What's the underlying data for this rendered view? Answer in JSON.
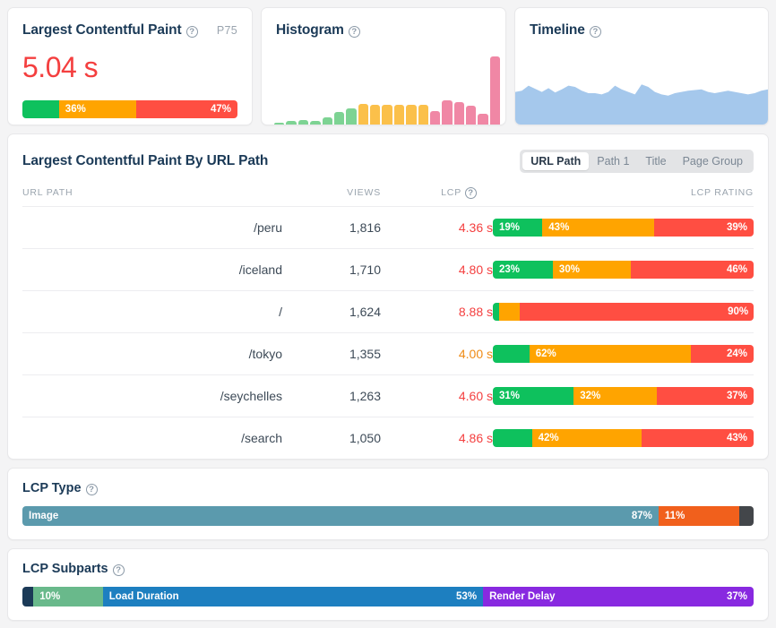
{
  "lcp_card": {
    "title": "Largest Contentful Paint",
    "help_icon": "question-mark-icon",
    "percentile_label": "P75",
    "value": "5.04 s",
    "rating_bar": [
      {
        "label": "",
        "pct": 17,
        "color": "#0ec15d",
        "align": "left"
      },
      {
        "label": "36%",
        "pct": 36,
        "color": "#ffa400",
        "align": "left"
      },
      {
        "label": "47%",
        "pct": 47,
        "color": "#ff4e42",
        "align": "right"
      }
    ]
  },
  "histogram_card": {
    "title": "Histogram",
    "help_icon": "question-mark-icon"
  },
  "timeline_card": {
    "title": "Timeline",
    "help_icon": "question-mark-icon",
    "series_color": "#a5c8ec"
  },
  "table_card": {
    "title": "Largest Contentful Paint By URL Path",
    "toggle": {
      "options": [
        "URL Path",
        "Path 1",
        "Title",
        "Page Group"
      ],
      "selected": "URL Path"
    },
    "columns": {
      "path": "URL PATH",
      "views": "VIEWS",
      "lcp": "LCP",
      "lcp_help_icon": "question-mark-icon",
      "rating": "LCP RATING"
    },
    "rows": [
      {
        "path": "/peru",
        "views": "1,816",
        "lcp": "4.36 s",
        "lcp_class": "poor",
        "segments": [
          {
            "label": "19%",
            "pct": 19,
            "color": "#0ec15d",
            "align": "left"
          },
          {
            "label": "43%",
            "pct": 43,
            "color": "#ffa400",
            "align": "left"
          },
          {
            "label": "39%",
            "pct": 38,
            "color": "#ff4e42",
            "align": "right"
          }
        ]
      },
      {
        "path": "/iceland",
        "views": "1,710",
        "lcp": "4.80 s",
        "lcp_class": "poor",
        "segments": [
          {
            "label": "23%",
            "pct": 23,
            "color": "#0ec15d",
            "align": "left"
          },
          {
            "label": "30%",
            "pct": 30,
            "color": "#ffa400",
            "align": "left"
          },
          {
            "label": "46%",
            "pct": 47,
            "color": "#ff4e42",
            "align": "right"
          }
        ]
      },
      {
        "path": "/",
        "views": "1,624",
        "lcp": "8.88 s",
        "lcp_class": "poor",
        "segments": [
          {
            "label": "",
            "pct": 2,
            "color": "#0ec15d",
            "align": "left"
          },
          {
            "label": "",
            "pct": 8,
            "color": "#ffa400",
            "align": "left"
          },
          {
            "label": "90%",
            "pct": 90,
            "color": "#ff4e42",
            "align": "right"
          }
        ]
      },
      {
        "path": "/tokyo",
        "views": "1,355",
        "lcp": "4.00 s",
        "lcp_class": "ni",
        "segments": [
          {
            "label": "",
            "pct": 14,
            "color": "#0ec15d",
            "align": "left"
          },
          {
            "label": "62%",
            "pct": 62,
            "color": "#ffa400",
            "align": "left"
          },
          {
            "label": "24%",
            "pct": 24,
            "color": "#ff4e42",
            "align": "right"
          }
        ]
      },
      {
        "path": "/seychelles",
        "views": "1,263",
        "lcp": "4.60 s",
        "lcp_class": "poor",
        "segments": [
          {
            "label": "31%",
            "pct": 31,
            "color": "#0ec15d",
            "align": "left"
          },
          {
            "label": "32%",
            "pct": 32,
            "color": "#ffa400",
            "align": "left"
          },
          {
            "label": "37%",
            "pct": 37,
            "color": "#ff4e42",
            "align": "right"
          }
        ]
      },
      {
        "path": "/search",
        "views": "1,050",
        "lcp": "4.86 s",
        "lcp_class": "poor",
        "segments": [
          {
            "label": "",
            "pct": 15,
            "color": "#0ec15d",
            "align": "left"
          },
          {
            "label": "42%",
            "pct": 42,
            "color": "#ffa400",
            "align": "left"
          },
          {
            "label": "43%",
            "pct": 43,
            "color": "#ff4e42",
            "align": "right"
          }
        ]
      }
    ]
  },
  "lcp_type_card": {
    "title": "LCP Type",
    "help_icon": "question-mark-icon",
    "segments": [
      {
        "label": "Image",
        "value": "87%",
        "pct": 87,
        "color": "#5b9aad",
        "align": "both"
      },
      {
        "label": "",
        "value": "11%",
        "pct": 11,
        "color": "#f1601c",
        "align": "left"
      },
      {
        "label": "",
        "value": "",
        "pct": 2.5,
        "color": "#43464a",
        "align": "left"
      }
    ]
  },
  "lcp_subparts_card": {
    "title": "LCP Subparts",
    "help_icon": "question-mark-icon",
    "segments": [
      {
        "label": "",
        "value": "",
        "pct": 1.5,
        "color": "#1b3a57",
        "align": "left"
      },
      {
        "label": "",
        "value": "10%",
        "pct": 9.5,
        "color": "#69b98b",
        "align": "left"
      },
      {
        "label": "Load Duration",
        "value": "53%",
        "pct": 52,
        "color": "#1d7fc0",
        "align": "both"
      },
      {
        "label": "Render Delay",
        "value": "37%",
        "pct": 37,
        "color": "#8829e0",
        "align": "both"
      }
    ]
  },
  "chart_data": [
    {
      "type": "bar",
      "title": "Histogram",
      "xlabel": "",
      "ylabel": "",
      "grid": false,
      "legend": "none",
      "categories": [
        "b1",
        "b2",
        "b3",
        "b4",
        "b5",
        "b6",
        "b7",
        "b8",
        "b9",
        "b10",
        "b11",
        "b12",
        "b13",
        "b14",
        "b15",
        "b16",
        "b17",
        "b18"
      ],
      "values": [
        2,
        4,
        5,
        4,
        8,
        13,
        17,
        22,
        21,
        21,
        21,
        21,
        21,
        14,
        26,
        24,
        20,
        11,
        72
      ],
      "colors": [
        "#7dd393",
        "#7dd393",
        "#7dd393",
        "#7dd393",
        "#7dd393",
        "#7dd393",
        "#7dd393",
        "#fbc04a",
        "#fbc04a",
        "#fbc04a",
        "#fbc04a",
        "#fbc04a",
        "#fbc04a",
        "#f087a5",
        "#f087a5",
        "#f087a5",
        "#f087a5",
        "#f087a5"
      ]
    },
    {
      "type": "area",
      "title": "Timeline",
      "xlabel": "",
      "ylabel": "",
      "grid": false,
      "legend": "none",
      "series": [
        {
          "name": "LCP",
          "values": [
            52,
            54,
            62,
            57,
            52,
            58,
            51,
            56,
            62,
            60,
            54,
            50,
            50,
            48,
            52,
            62,
            56,
            52,
            48,
            64,
            60,
            52,
            48,
            46,
            50,
            52,
            54,
            55,
            56,
            52,
            50,
            52,
            54,
            52,
            50,
            48,
            50,
            54,
            56
          ]
        }
      ]
    }
  ]
}
